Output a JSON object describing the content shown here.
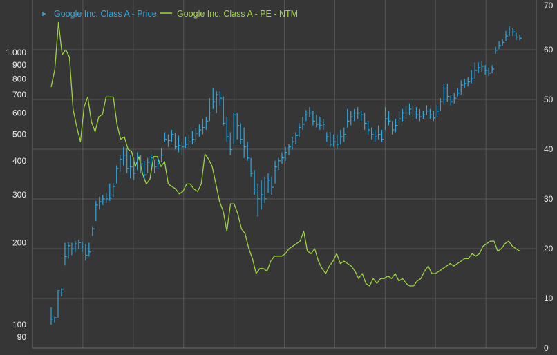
{
  "chart_data": {
    "type": "line",
    "grid": true,
    "legend_position": "top-left",
    "series": [
      {
        "name": "Google Inc. Class A - Price",
        "color": "#2fa8e0",
        "axis": "left",
        "style": "hlc-bars",
        "hlc": [
          [
            100,
            116,
            104
          ],
          [
            102,
            107,
            106
          ],
          [
            106,
            134,
            133
          ],
          [
            127,
            136,
            135
          ],
          [
            165,
            200,
            178
          ],
          [
            175,
            201,
            195
          ],
          [
            180,
            200,
            190
          ],
          [
            185,
            203,
            198
          ],
          [
            190,
            205,
            200
          ],
          [
            185,
            202,
            193
          ],
          [
            172,
            198,
            180
          ],
          [
            178,
            200,
            185
          ],
          [
            212,
            230,
            225
          ],
          [
            240,
            285,
            275
          ],
          [
            265,
            295,
            283
          ],
          [
            275,
            300,
            290
          ],
          [
            280,
            305,
            290
          ],
          [
            285,
            330,
            292
          ],
          [
            295,
            332,
            322
          ],
          [
            330,
            385,
            375
          ],
          [
            365,
            420,
            405
          ],
          [
            385,
            450,
            420
          ],
          [
            360,
            445,
            375
          ],
          [
            345,
            420,
            380
          ],
          [
            340,
            410,
            360
          ],
          [
            370,
            430,
            420
          ],
          [
            360,
            420,
            390
          ],
          [
            345,
            400,
            355
          ],
          [
            360,
            410,
            395
          ],
          [
            380,
            425,
            410
          ],
          [
            360,
            405,
            380
          ],
          [
            375,
            410,
            390
          ],
          [
            395,
            445,
            420
          ],
          [
            470,
            510,
            480
          ],
          [
            450,
            500,
            475
          ],
          [
            470,
            520,
            500
          ],
          [
            440,
            505,
            450
          ],
          [
            430,
            495,
            455
          ],
          [
            420,
            470,
            450
          ],
          [
            445,
            490,
            460
          ],
          [
            450,
            500,
            470
          ],
          [
            460,
            515,
            480
          ],
          [
            470,
            530,
            505
          ],
          [
            490,
            545,
            520
          ],
          [
            500,
            570,
            530
          ],
          [
            520,
            580,
            560
          ],
          [
            560,
            680,
            600
          ],
          [
            620,
            740,
            660
          ],
          [
            600,
            720,
            700
          ],
          [
            640,
            720,
            680
          ],
          [
            540,
            690,
            550
          ],
          [
            470,
            580,
            490
          ],
          [
            420,
            510,
            440
          ],
          [
            460,
            600,
            590
          ],
          [
            480,
            600,
            540
          ],
          [
            460,
            550,
            480
          ],
          [
            410,
            530,
            450
          ],
          [
            400,
            470,
            410
          ],
          [
            350,
            410,
            360
          ],
          [
            300,
            370,
            310
          ],
          [
            250,
            330,
            290
          ],
          [
            265,
            340,
            300
          ],
          [
            280,
            350,
            290
          ],
          [
            305,
            360,
            340
          ],
          [
            300,
            350,
            320
          ],
          [
            330,
            400,
            380
          ],
          [
            370,
            410,
            400
          ],
          [
            390,
            430,
            410
          ],
          [
            400,
            450,
            430
          ],
          [
            420,
            460,
            450
          ],
          [
            440,
            490,
            470
          ],
          [
            460,
            510,
            495
          ],
          [
            490,
            550,
            530
          ],
          [
            520,
            580,
            545
          ],
          [
            560,
            615,
            600
          ],
          [
            580,
            630,
            600
          ],
          [
            540,
            610,
            560
          ],
          [
            530,
            590,
            545
          ],
          [
            520,
            580,
            540
          ],
          [
            520,
            570,
            545
          ],
          [
            470,
            510,
            490
          ],
          [
            450,
            510,
            460
          ],
          [
            450,
            500,
            470
          ],
          [
            440,
            500,
            460
          ],
          [
            460,
            520,
            490
          ],
          [
            470,
            530,
            500
          ],
          [
            530,
            620,
            560
          ],
          [
            540,
            610,
            580
          ],
          [
            560,
            620,
            600
          ],
          [
            570,
            630,
            600
          ],
          [
            560,
            610,
            590
          ],
          [
            520,
            600,
            550
          ],
          [
            500,
            560,
            520
          ],
          [
            480,
            530,
            500
          ],
          [
            470,
            520,
            490
          ],
          [
            480,
            540,
            500
          ],
          [
            470,
            520,
            480
          ],
          [
            520,
            630,
            570
          ],
          [
            540,
            610,
            560
          ],
          [
            500,
            560,
            520
          ],
          [
            510,
            570,
            540
          ],
          [
            540,
            610,
            570
          ],
          [
            560,
            620,
            600
          ],
          [
            570,
            640,
            600
          ],
          [
            590,
            650,
            620
          ],
          [
            580,
            640,
            600
          ],
          [
            570,
            630,
            590
          ],
          [
            560,
            620,
            580
          ],
          [
            570,
            610,
            590
          ],
          [
            590,
            640,
            610
          ],
          [
            570,
            620,
            590
          ],
          [
            560,
            610,
            575
          ],
          [
            580,
            640,
            610
          ],
          [
            610,
            680,
            660
          ],
          [
            650,
            770,
            740
          ],
          [
            660,
            770,
            690
          ],
          [
            640,
            700,
            660
          ],
          [
            650,
            710,
            680
          ],
          [
            690,
            740,
            710
          ],
          [
            700,
            790,
            760
          ],
          [
            740,
            800,
            770
          ],
          [
            750,
            810,
            780
          ],
          [
            770,
            860,
            800
          ],
          [
            800,
            920,
            860
          ],
          [
            840,
            920,
            880
          ],
          [
            850,
            930,
            890
          ],
          [
            830,
            900,
            860
          ],
          [
            820,
            880,
            840
          ],
          [
            840,
            900,
            870
          ],
          [
            990,
            1050,
            1020
          ],
          [
            1030,
            1100,
            1060
          ],
          [
            1060,
            1120,
            1090
          ],
          [
            1100,
            1200,
            1150
          ],
          [
            1150,
            1250,
            1210
          ],
          [
            1150,
            1230,
            1190
          ],
          [
            1110,
            1180,
            1140
          ],
          [
            1110,
            1160,
            1130
          ]
        ]
      },
      {
        "name": "Google Inc. Class A - PE - NTM",
        "color": "#9ed640",
        "axis": "right",
        "style": "line",
        "values": [
          52.5,
          56,
          65.5,
          59,
          60,
          58.5,
          48,
          44.5,
          41.5,
          48.5,
          50.5,
          45.5,
          43.5,
          46.5,
          47,
          50.5,
          50.5,
          50.5,
          45,
          42,
          42.5,
          40,
          39.5,
          36.5,
          38.5,
          35,
          33,
          34,
          38.5,
          38.5,
          36.5,
          37.5,
          33,
          32.5,
          32,
          31,
          31.5,
          33,
          33,
          32,
          31.5,
          33,
          39,
          38,
          36.5,
          33,
          29.5,
          27.5,
          23.5,
          29,
          29,
          27,
          24,
          23,
          20,
          18,
          15,
          16,
          16,
          15.5,
          17.5,
          18.5,
          18.5,
          18.5,
          19,
          20,
          20.5,
          21,
          21.5,
          23.5,
          19.5,
          19,
          20,
          17.5,
          16,
          15,
          16.5,
          17.5,
          19,
          17,
          17.5,
          17,
          16.5,
          15.5,
          14,
          15,
          13,
          12.5,
          14,
          13,
          14,
          14,
          14.5,
          14,
          15,
          13.5,
          14,
          13,
          12.5,
          12.5,
          13.5,
          14,
          15.5,
          16.5,
          15,
          15,
          15.5,
          16,
          16.5,
          17,
          16.5,
          17,
          17.5,
          18,
          18,
          19,
          18.5,
          19,
          20.5,
          21,
          21.5,
          21.5,
          19.5,
          20,
          21,
          21.5,
          20.5,
          20,
          19.5
        ]
      }
    ],
    "y_left": {
      "scale": "log",
      "ylim": [
        82,
        1560
      ],
      "ticks": [
        100,
        200,
        300,
        400,
        500,
        600,
        700,
        800,
        900,
        1000
      ],
      "minor_ticks": [
        90
      ],
      "tick_labels": [
        "100",
        "200",
        "300",
        "400",
        "500",
        "600",
        "700",
        "800",
        "900",
        "1.000"
      ],
      "minor_tick_labels": [
        "90"
      ]
    },
    "y_right": {
      "scale": "linear",
      "ylim": [
        0,
        70
      ],
      "ticks": [
        0,
        10,
        20,
        30,
        40,
        50,
        60,
        70
      ],
      "tick_labels": [
        "0",
        "10",
        "20",
        "30",
        "40",
        "50",
        "60",
        "70"
      ]
    },
    "x_gridlines": 10
  }
}
